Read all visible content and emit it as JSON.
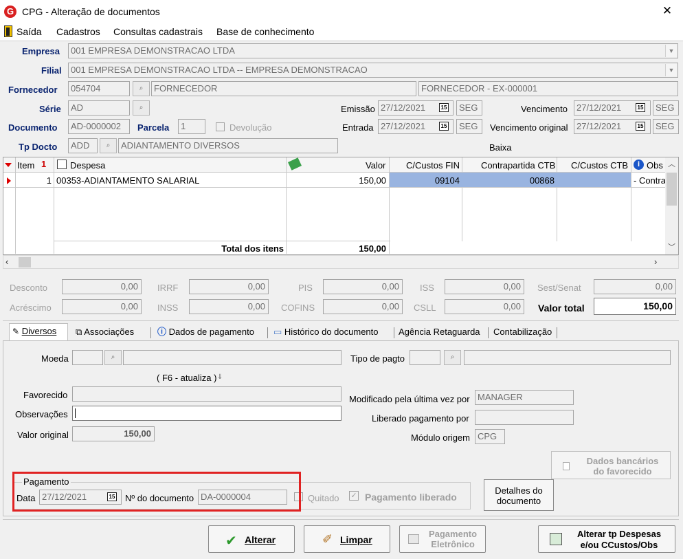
{
  "window": {
    "title": "CPG - Alteração de documentos",
    "close": "✕"
  },
  "menu": {
    "items": [
      "Saída",
      "Cadastros",
      "Consultas cadastrais",
      "Base de conhecimento"
    ]
  },
  "header": {
    "empresa_label": "Empresa",
    "empresa_value": "001 EMPRESA DEMONSTRACAO LTDA",
    "filial_label": "Filial",
    "filial_value": "001 EMPRESA DEMONSTRACAO LTDA -- EMPRESA DEMONSTRACAO",
    "fornecedor_label": "Fornecedor",
    "fornecedor_code": "054704",
    "fornecedor_name": "FORNECEDOR",
    "fornecedor_ex": "FORNECEDOR - EX-000001",
    "serie_label": "Série",
    "serie_value": "AD",
    "documento_label": "Documento",
    "documento_value": "AD-0000002",
    "parcela_label": "Parcela",
    "parcela_value": "1",
    "devolucao_label": "Devolução",
    "tpdocto_label": "Tp Docto",
    "tpdocto_code": "ADD",
    "tpdocto_name": "ADIANTAMENTO DIVERSOS",
    "emissao_label": "Emissão",
    "emissao_date": "27/12/2021",
    "emissao_day": "SEG",
    "entrada_label": "Entrada",
    "entrada_date": "27/12/2021",
    "entrada_day": "SEG",
    "vencimento_label": "Vencimento",
    "vencimento_date": "27/12/2021",
    "vencimento_day": "SEG",
    "venc_orig_label": "Vencimento original",
    "venc_orig_date": "27/12/2021",
    "venc_orig_day": "SEG",
    "baixa_label": "Baixa",
    "cal_glyph": "15"
  },
  "grid": {
    "columns": {
      "item": "Item",
      "item_sort": "1",
      "despesa": "Despesa",
      "valor": "Valor",
      "cc_fin": "C/Custos FIN",
      "contra_ctb": "Contrapartida CTB",
      "cc_ctb": "C/Custos CTB",
      "obs": "Obs"
    },
    "rows": [
      {
        "item": "1",
        "despesa": "00353-ADIANTAMENTO SALARIAL",
        "valor": "150,00",
        "cc_fin": "09104",
        "contra_ctb": "00868",
        "cc_ctb": "",
        "obs": "- Contra"
      }
    ],
    "total_label": "Total dos itens",
    "total_value": "150,00"
  },
  "totals": {
    "desconto_label": "Desconto",
    "desconto": "0,00",
    "irrf_label": "IRRF",
    "irrf": "0,00",
    "pis_label": "PIS",
    "pis": "0,00",
    "iss_label": "ISS",
    "iss": "0,00",
    "sest_label": "Sest/Senat",
    "sest": "0,00",
    "acrescimo_label": "Acréscimo",
    "acrescimo": "0,00",
    "inss_label": "INSS",
    "inss": "0,00",
    "cofins_label": "COFINS",
    "cofins": "0,00",
    "csll_label": "CSLL",
    "csll": "0,00",
    "valor_total_label": "Valor total",
    "valor_total": "150,00"
  },
  "tabs": [
    "Diversos",
    "Associações",
    "Dados de pagamento",
    "Histórico do documento",
    "Agência Retaguarda",
    "Contabilização"
  ],
  "diversos": {
    "moeda_label": "Moeda",
    "f6_label": "( F6 - atualiza )",
    "favorecido_label": "Favorecido",
    "observacoes_label": "Observações",
    "valor_original_label": "Valor original",
    "valor_original": "150,00",
    "tipo_pagto_label": "Tipo de pagto",
    "modificado_label": "Modificado pela última vez por",
    "modificado_value": "MANAGER",
    "liberado_label": "Liberado pagamento por",
    "modulo_label": "Módulo origem",
    "modulo_value": "CPG",
    "dados_bancarios_line1": "Dados bancários",
    "dados_bancarios_line2": "do favorecido",
    "pagamento_group": "Pagamento",
    "data_label": "Data",
    "data_value": "27/12/2021",
    "ndoc_label": "Nº do documento",
    "ndoc_value": "DA-0000004",
    "quitado_label": "Quitado",
    "pag_liberado_label": "Pagamento liberado",
    "detalhes_line1": "Detalhes do",
    "detalhes_line2": "documento"
  },
  "footer": {
    "alterar": "Alterar",
    "limpar": "Limpar",
    "pag_eletronico_line1": "Pagamento",
    "pag_eletronico_line2": "Eletrônico",
    "alterar_tp_line1": "Alterar tp Despesas",
    "alterar_tp_line2": "e/ou CCustos/Obs"
  },
  "colors": {
    "accent_selection": "#99b4e0",
    "highlight_box": "#e02222",
    "label_blue": "#0a2470"
  }
}
